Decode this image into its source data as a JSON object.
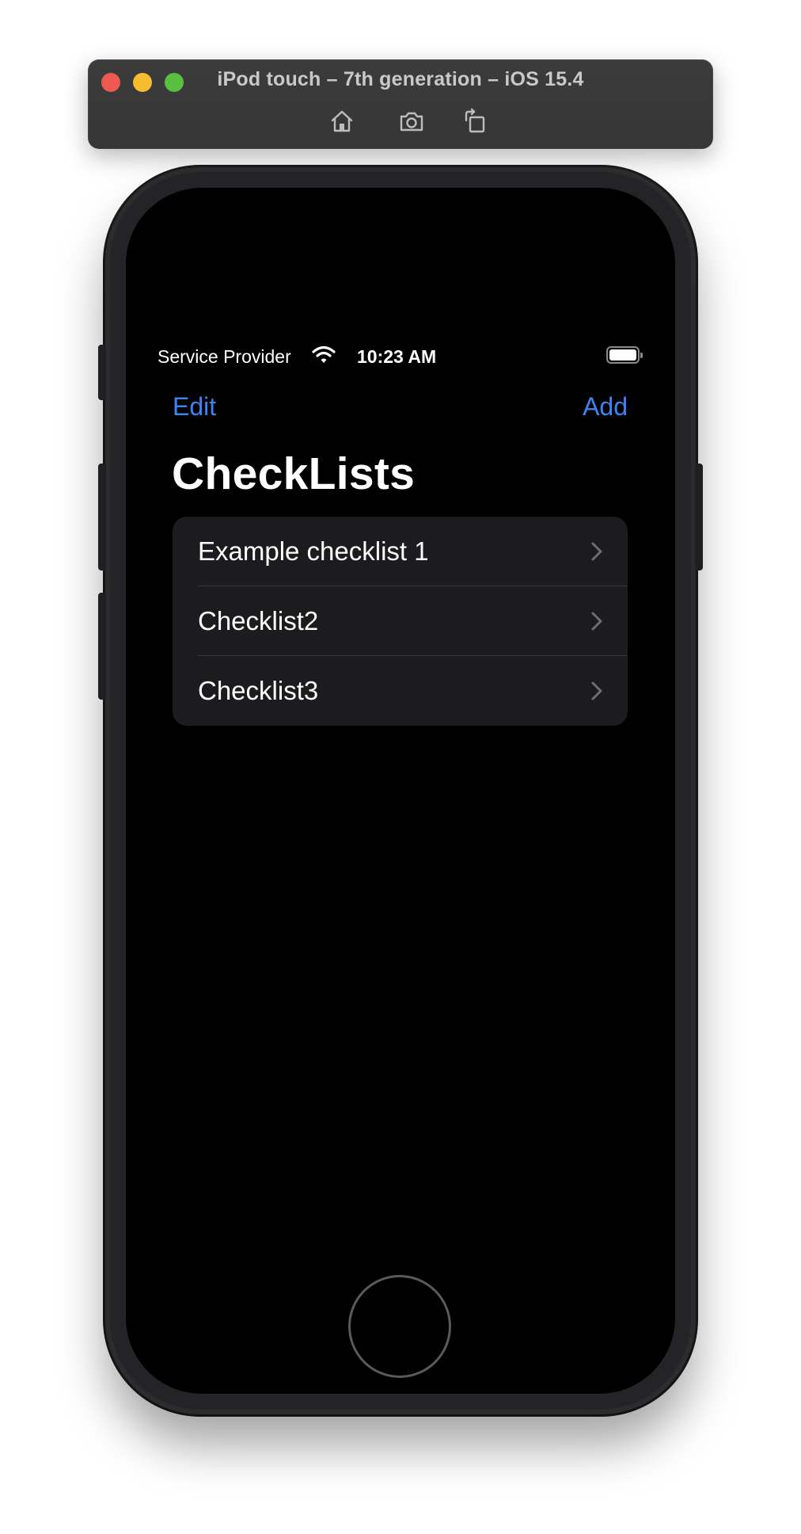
{
  "simulator": {
    "title": "iPod touch – 7th generation – iOS 15.4",
    "toolbar": [
      "home-icon",
      "screenshot-icon",
      "rotate-icon"
    ]
  },
  "status_bar": {
    "carrier": "Service Provider",
    "time": "10:23 AM",
    "battery_level": 1.0
  },
  "nav": {
    "edit_label": "Edit",
    "add_label": "Add",
    "title": "CheckLists"
  },
  "list": {
    "items": [
      {
        "label": "Example checklist 1"
      },
      {
        "label": "Checklist2"
      },
      {
        "label": "Checklist3"
      }
    ]
  },
  "colors": {
    "accent": "#3d84f1",
    "background": "#000000",
    "cell": "#1c1c1e"
  }
}
